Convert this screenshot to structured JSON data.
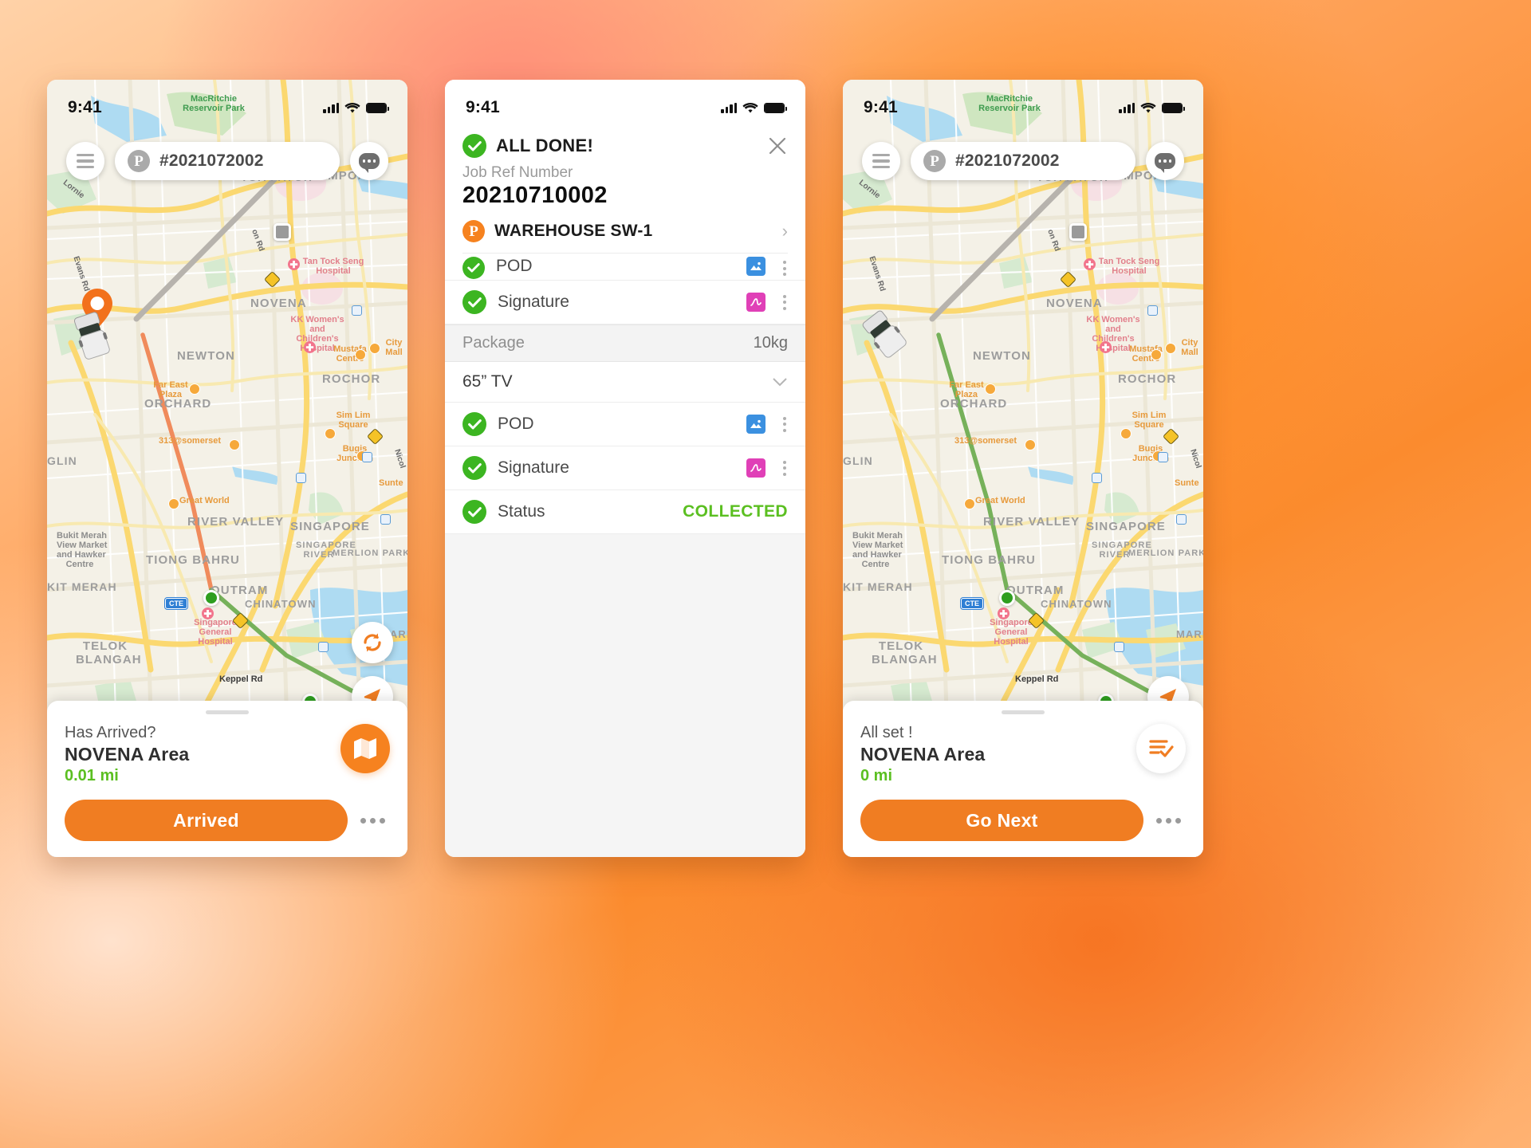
{
  "theme": {
    "accent_orange": "#f6821f",
    "cta_orange": "#f07d22",
    "success_green": "#5bbf21",
    "check_green": "#3cb521",
    "photo_blue": "#3b90e0",
    "signature_magenta": "#e040b7",
    "route_orange": "#f08b5c",
    "route_green": "#76b15a"
  },
  "status_bar": {
    "time": "9:41"
  },
  "map": {
    "regions": [
      "WHAMPOA",
      "NOVENA",
      "NEWTON",
      "ROCHOR",
      "ORCHARD",
      "RIVER VALLEY",
      "SINGAPORE",
      "TIONG BAHRU",
      "OUTRAM",
      "CHINATOWN",
      "TELOK BLANGAH",
      "BUKIT MERAH",
      "TOA PAYOH",
      "GLIN",
      "SINGAPORE RIVER",
      "MERLION PARK",
      "MARI"
    ],
    "parks": [
      "MacRitchie Reservoir Park"
    ],
    "hospitals": [
      "Tan Tock Seng Hospital",
      "KK Women's and Children's Hospital",
      "Singapore General Hospital"
    ],
    "pois": [
      "Mustafa Centre",
      "City Mall",
      "Far East Plaza",
      "Sim Lim Square",
      "313@somerset",
      "Bugis Junction",
      "Great World",
      "Suntec",
      "Bukit Merah View Market and Hawker Centre"
    ],
    "roads": [
      "Evans Rd",
      "Lornie Rd",
      "Moulmein Rd",
      "Keppel Rd",
      "Nicoll"
    ],
    "highway_shield": "CTE"
  },
  "phone1": {
    "topbar": {
      "menu_icon": "hamburger-icon",
      "job_badge": "P",
      "job_number": "#2021072002",
      "chat_icon": "chat-bubble-icon"
    },
    "float_buttons": [
      {
        "name": "refresh-button",
        "icon": "refresh-icon"
      },
      {
        "name": "navigate-button",
        "icon": "navigation-arrow-icon"
      }
    ],
    "sheet": {
      "title": "Has Arrived?",
      "place": "NOVENA Area",
      "distance": "0.01 mi",
      "side_icon": "map-icon",
      "cta_label": "Arrived",
      "more_icon": "more-horizontal-icon"
    }
  },
  "phone2": {
    "header": {
      "done_label": "ALL DONE!",
      "close_icon": "close-icon",
      "jobref_label": "Job Ref Number",
      "jobref_value": "20210710002",
      "warehouse_badge": "P",
      "warehouse_name": "WAREHOUSE SW-1",
      "chevron_icon": "chevron-right-icon"
    },
    "rows_top": [
      {
        "label": "POD",
        "tile": "photo-icon",
        "tile_kind": "photo",
        "checked": true,
        "clipped": true
      },
      {
        "label": "Signature",
        "tile": "signature-icon",
        "tile_kind": "sign",
        "checked": true,
        "clipped": false
      }
    ],
    "package": {
      "label": "Package",
      "weight": "10kg",
      "item": "65” TV",
      "expand_icon": "chevron-down-icon"
    },
    "rows_bottom": [
      {
        "label": "POD",
        "tile": "photo-icon",
        "tile_kind": "photo",
        "checked": true
      },
      {
        "label": "Signature",
        "tile": "signature-icon",
        "tile_kind": "sign",
        "checked": true
      }
    ],
    "status_row": {
      "label": "Status",
      "value": "COLLECTED",
      "checked": true
    }
  },
  "phone3": {
    "topbar": {
      "menu_icon": "hamburger-icon",
      "job_badge": "P",
      "job_number": "#2021072002",
      "chat_icon": "chat-bubble-icon"
    },
    "float_buttons": [
      {
        "name": "navigate-button",
        "icon": "navigation-arrow-icon"
      }
    ],
    "sheet": {
      "title": "All set !",
      "place": "NOVENA Area",
      "distance": "0 mi",
      "side_icon": "checklist-icon",
      "cta_label": "Go Next",
      "more_icon": "more-horizontal-icon"
    }
  }
}
